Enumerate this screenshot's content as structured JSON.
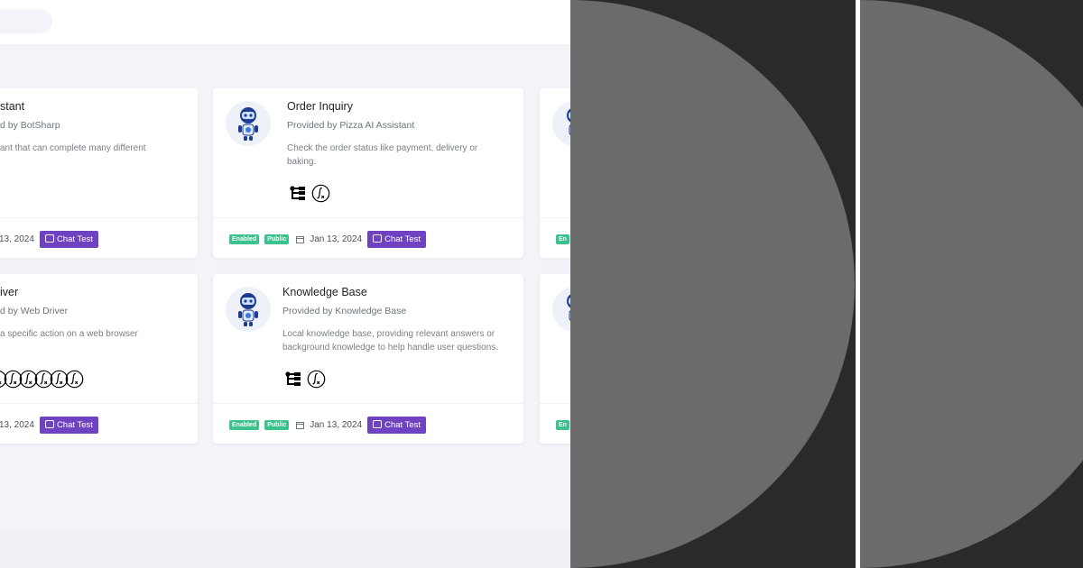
{
  "cards": [
    {
      "title": "stant",
      "provider": "d by BotSharp",
      "description": "ant that can complete many different",
      "badges": [],
      "date": "13, 2024",
      "button": "Chat Test"
    },
    {
      "title": "Order Inquiry",
      "provider": "Provided by Pizza AI Assistant",
      "description": "Check the order status like payment, delivery or baking.",
      "badges": [
        "Enabled",
        "Public"
      ],
      "date": "Jan 13, 2024",
      "button": "Chat Test"
    },
    {
      "badges": [
        "En"
      ]
    },
    {
      "title": "iver",
      "provider": "d by Web Driver",
      "description": "a specific action on a web browser",
      "badges": [],
      "date": "13, 2024",
      "button": "Chat Test"
    },
    {
      "title": "Knowledge Base",
      "provider": "Provided by Knowledge Base",
      "description": "Local knowledge base, providing relevant answers or background knowledge to help handle user questions.",
      "badges": [
        "Enabled",
        "Public"
      ],
      "date": "Jan 13, 2024",
      "button": "Chat Test"
    },
    {
      "badges": [
        "En"
      ]
    }
  ],
  "icons": {
    "avatar": "robot-icon",
    "tree": "tree-structure-icon",
    "function": "function-icon",
    "calendar": "calendar-icon",
    "chat": "chat-bubble-icon"
  },
  "colors": {
    "accent": "#6f42c1",
    "badge": "#3cc28d",
    "background": "#f3f3f8",
    "dark_panel": "#2a2a2a",
    "circle": "#6b6b6b"
  }
}
